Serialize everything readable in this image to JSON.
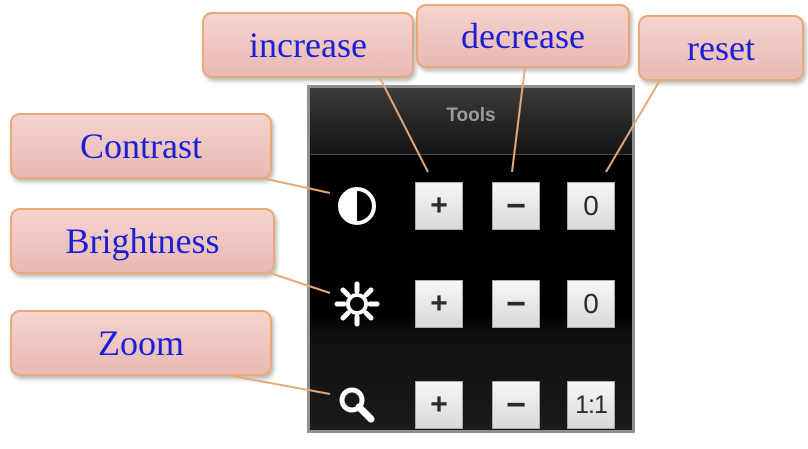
{
  "callouts": {
    "increase": "increase",
    "decrease": "decrease",
    "reset": "reset",
    "contrast": "Contrast",
    "brightness": "Brightness",
    "zoom": "Zoom"
  },
  "panel": {
    "title": "Tools",
    "rows": [
      {
        "id": "contrast",
        "icon": "contrast-icon",
        "increase_label": "+",
        "decrease_label": "−",
        "reset_label": "0"
      },
      {
        "id": "brightness",
        "icon": "brightness-sun-icon",
        "increase_label": "+",
        "decrease_label": "−",
        "reset_label": "0"
      },
      {
        "id": "zoom",
        "icon": "magnifier-icon",
        "increase_label": "+",
        "decrease_label": "−",
        "reset_label": "1:1"
      }
    ]
  },
  "colors": {
    "callout_text": "#1a1fd6",
    "callout_fill": "#f0c8c3",
    "callout_border": "#e8a878",
    "panel_background": "#000000",
    "button_face": "#e8e8e8"
  }
}
